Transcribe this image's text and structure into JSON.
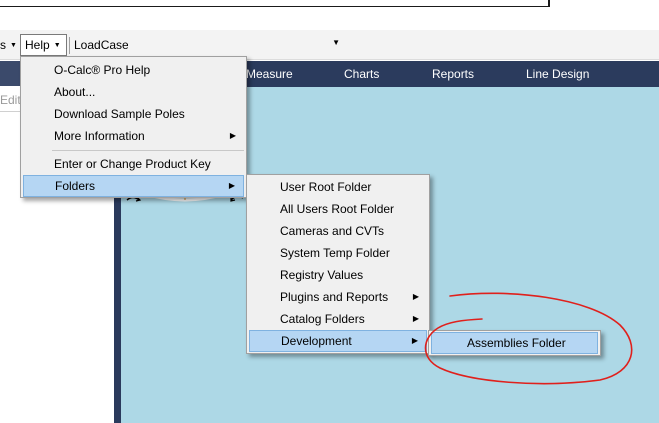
{
  "toolbar": {
    "prev_menu_label": "s",
    "help_label": "Help",
    "loadcase_label": "LoadCase:",
    "loadcase_value": ""
  },
  "left_panel": {
    "edit_label": "Edit"
  },
  "ribbon": {
    "tabs": [
      "Measure",
      "Charts",
      "Reports",
      "Line Design"
    ]
  },
  "help_menu": {
    "items": [
      {
        "label": "O-Calc® Pro Help"
      },
      {
        "label": "About..."
      },
      {
        "label": "Download Sample Poles"
      },
      {
        "label": "More Information"
      },
      {
        "label": "Enter or Change Product Key"
      },
      {
        "label": "Folders"
      }
    ]
  },
  "folders_menu": {
    "items": [
      {
        "label": "User Root Folder"
      },
      {
        "label": "All Users Root Folder"
      },
      {
        "label": "Cameras and CVTs"
      },
      {
        "label": "System Temp Folder"
      },
      {
        "label": "Registry Values"
      },
      {
        "label": "Plugins and Reports"
      },
      {
        "label": "Catalog Folders"
      },
      {
        "label": "Development"
      }
    ]
  },
  "development_menu": {
    "items": [
      {
        "label": "Assemblies Folder"
      }
    ]
  },
  "colors": {
    "ribbon": "#2b3b5d",
    "canvas": "#add8e6",
    "highlight": "#b5d6f3",
    "annotation": "#e0201c"
  }
}
